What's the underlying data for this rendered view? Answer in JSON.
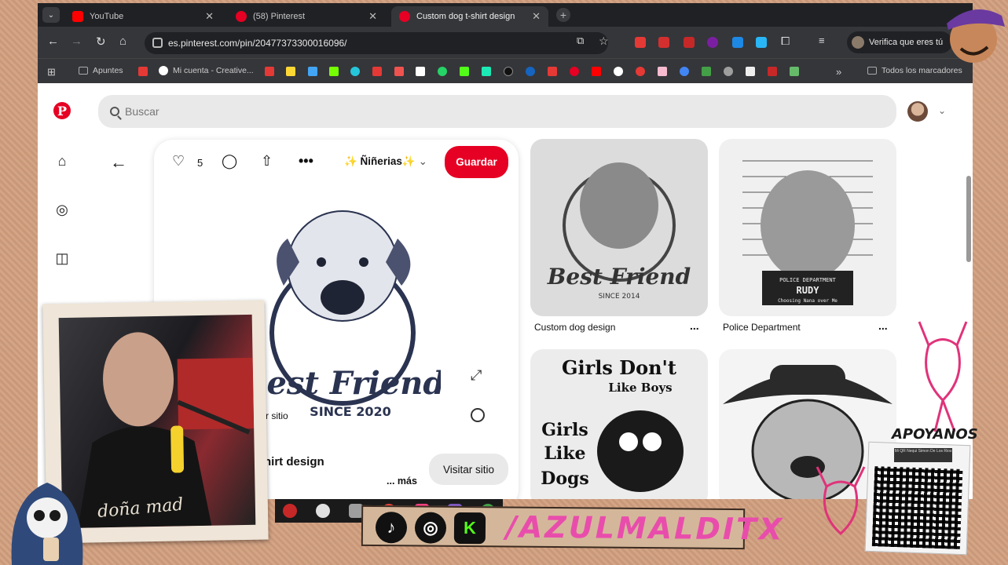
{
  "browser": {
    "tabs": [
      {
        "label": "YouTube",
        "color": "#ff0000"
      },
      {
        "label": "(58) Pinterest",
        "color": "#e60023"
      },
      {
        "label": "Custom dog t-shirt design",
        "color": "#e60023",
        "active": true
      }
    ],
    "url": "es.pinterest.com/pin/20477373300016096/",
    "profile_label": "Verifica que eres tú",
    "bookmarks": {
      "apuntes": "Apuntes",
      "mi_cuenta": "Mi cuenta - Creative...",
      "todos": "Todos los marcadores",
      "more": "»"
    }
  },
  "pinterest": {
    "search_placeholder": "Buscar",
    "like_count": "5",
    "board_name": "✨ Ñiñerias✨",
    "save_label": "Guardar",
    "pin_title": "hirt design",
    "visit_small": "r sitio",
    "more_label": "... más",
    "visit_label": "Visitar sitio",
    "brand_color": "#e60023",
    "image_text": {
      "main": "Best Friend",
      "main_sub": "SINCE 2020",
      "g1": "Best Friend",
      "g1_sub": "SINCE 2014",
      "g2_top": "POLICE DEPARTMENT",
      "g2_name": "RUDY",
      "g2_sub": "Choosing Nana over Me",
      "g3_l1": "Girls Don't",
      "g3_l2": "Like Boys",
      "g3_l3": "Girls",
      "g3_l4": "Like",
      "g3_l5": "Dogs"
    },
    "grid": [
      {
        "title": "Custom dog design",
        "dots": "..."
      },
      {
        "title": "Police Department",
        "dots": "..."
      },
      {
        "title": "",
        "dots": ""
      },
      {
        "title": "",
        "dots": ""
      }
    ]
  },
  "overlay": {
    "handle": "/AZULMALDITX",
    "apoyanos": "APOYANOS",
    "qr_caption": "Mi QR Nequi Simon De Los Rios",
    "shirt_text": "doña mad"
  }
}
